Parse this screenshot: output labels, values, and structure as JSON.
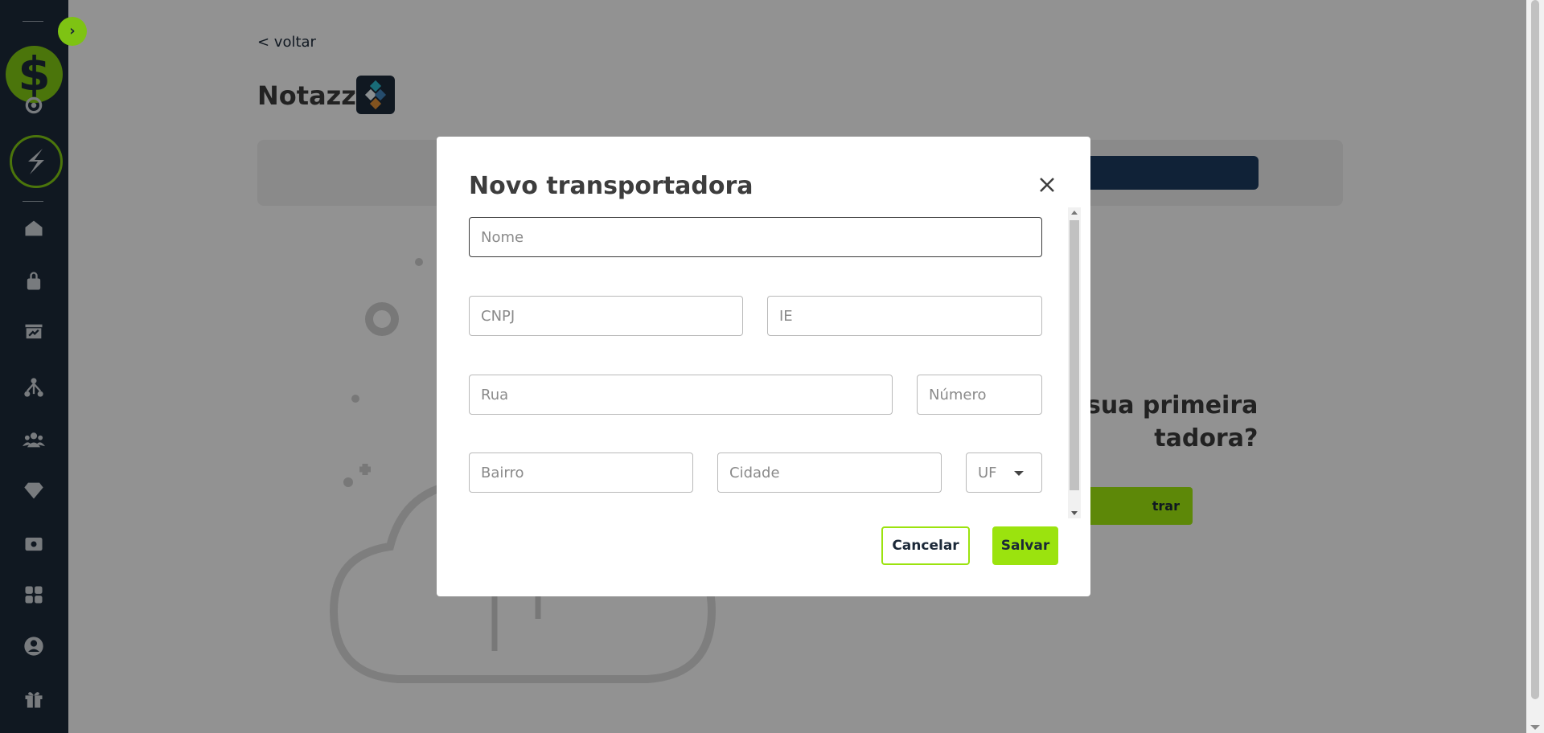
{
  "sidebar": {
    "toggle_icon": "chevron-right-icon",
    "logo_symbol": "$",
    "items": [
      {
        "name": "home",
        "icon": "home-icon"
      },
      {
        "name": "products",
        "icon": "shopping-bag-icon"
      },
      {
        "name": "dashboard",
        "icon": "presentation-chart-icon"
      },
      {
        "name": "affiliates",
        "icon": "network-icon"
      },
      {
        "name": "users",
        "icon": "users-icon"
      },
      {
        "name": "gems",
        "icon": "diamond-icon"
      },
      {
        "name": "finance",
        "icon": "money-icon"
      },
      {
        "name": "apps",
        "icon": "grid-icon"
      },
      {
        "name": "account",
        "icon": "user-circle-icon"
      },
      {
        "name": "gifts",
        "icon": "gift-icon"
      }
    ]
  },
  "page": {
    "back_label": "< voltar",
    "title": "Notazz",
    "empty_heading_line1": "sua primeira",
    "empty_heading_line2": "tadora?",
    "empty_button_label": "trar"
  },
  "modal": {
    "title": "Novo transportadora",
    "close_icon": "close-icon",
    "fields": {
      "nome": {
        "placeholder": "Nome",
        "value": ""
      },
      "cnpj": {
        "placeholder": "CNPJ",
        "value": ""
      },
      "ie": {
        "placeholder": "IE",
        "value": ""
      },
      "rua": {
        "placeholder": "Rua",
        "value": ""
      },
      "numero": {
        "placeholder": "Número",
        "value": ""
      },
      "bairro": {
        "placeholder": "Bairro",
        "value": ""
      },
      "cidade": {
        "placeholder": "Cidade",
        "value": ""
      },
      "uf": {
        "selected": "UF"
      }
    },
    "cancel_label": "Cancelar",
    "save_label": "Salvar"
  },
  "colors": {
    "sidebar_bg": "#1b2838",
    "accent_green": "#9be30e",
    "logo_green": "#7ec313",
    "text_dark": "#3d3d3d"
  }
}
